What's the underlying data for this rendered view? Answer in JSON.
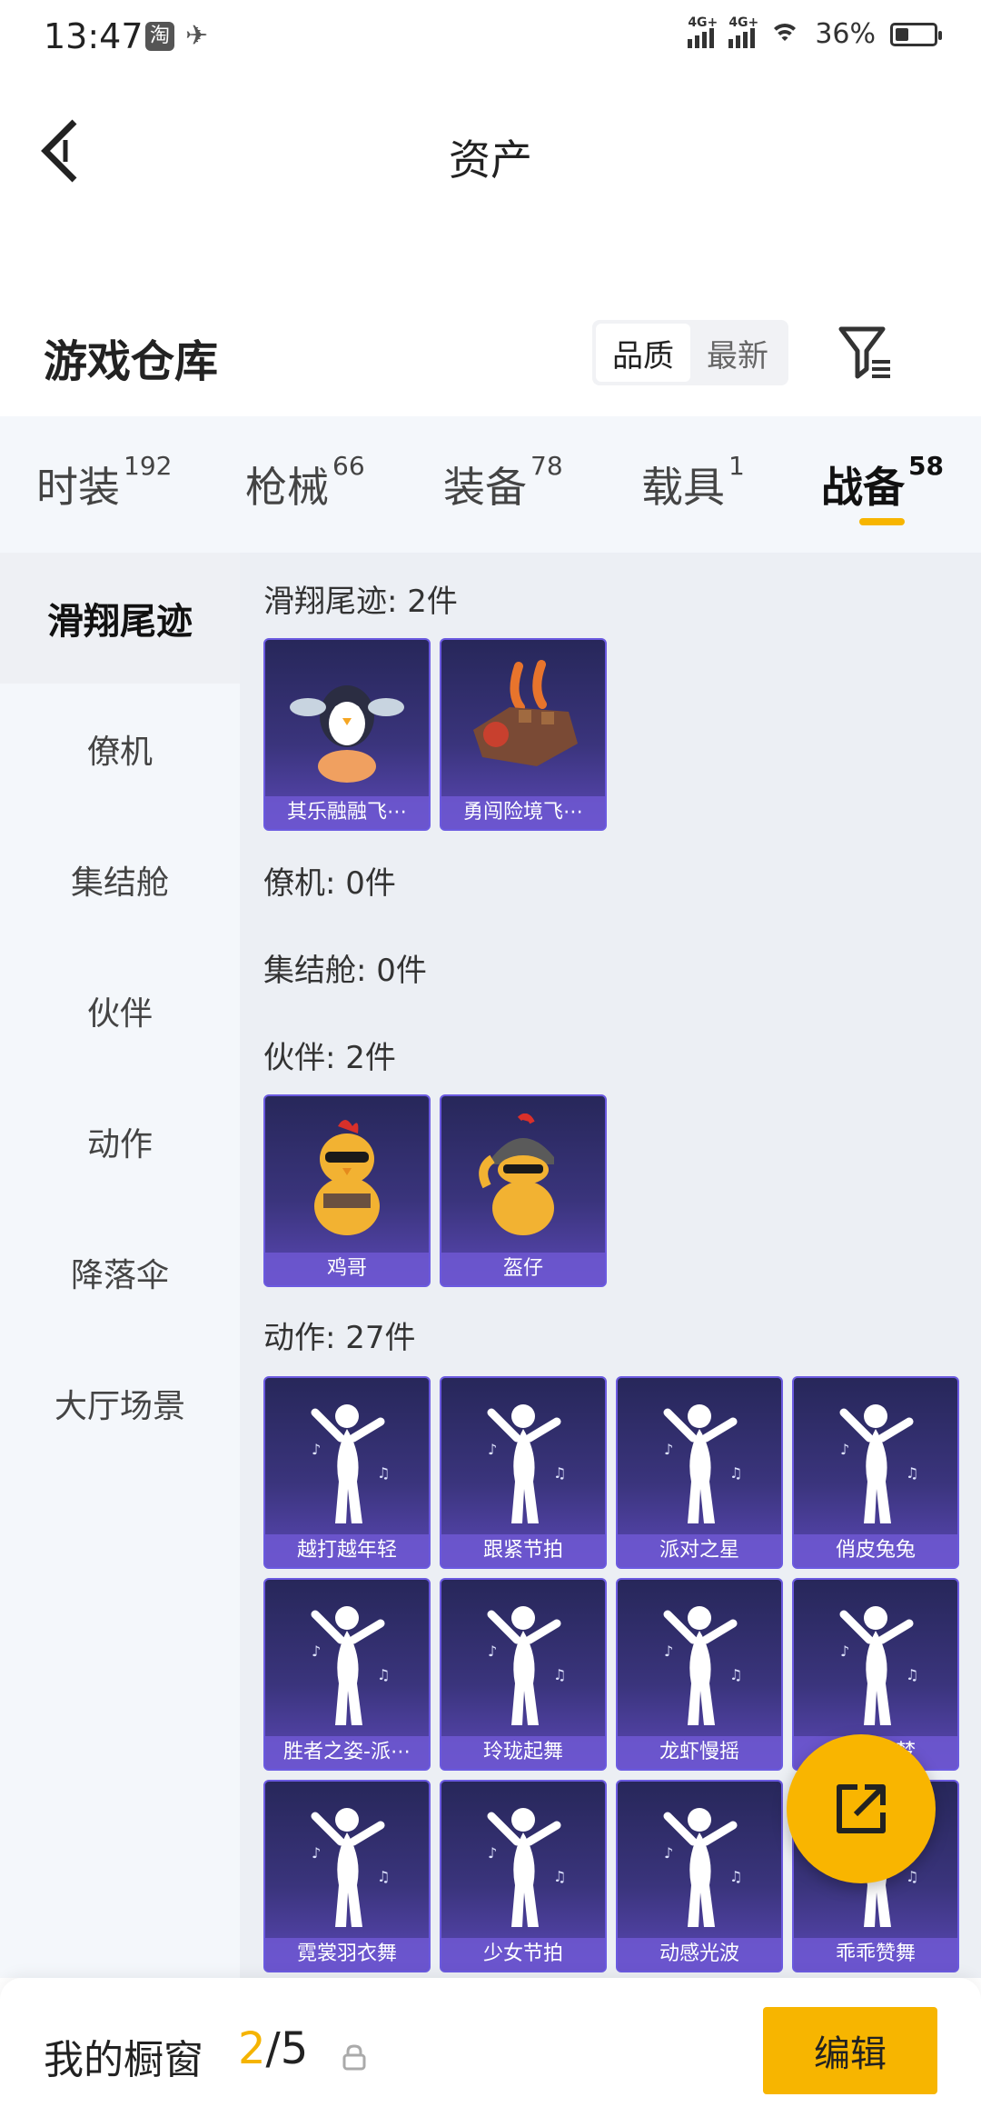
{
  "status_bar": {
    "time": "13:47",
    "app_icon_1": "taobao-icon",
    "app_icon_2": "fish-icon",
    "network_1": "4G+",
    "network_2": "4G+",
    "battery_percent": "36%",
    "battery_level": 0.36
  },
  "header": {
    "title": "资产",
    "back_icon": "back-chevron-icon"
  },
  "warehouse": {
    "title": "游戏仓库",
    "sort_options": [
      "品质",
      "最新"
    ],
    "sort_selected": "品质",
    "filter_icon": "filter-icon"
  },
  "tabs": [
    {
      "label": "时装",
      "count": "192"
    },
    {
      "label": "枪械",
      "count": "66"
    },
    {
      "label": "装备",
      "count": "78"
    },
    {
      "label": "载具",
      "count": "1"
    },
    {
      "label": "战备",
      "count": "58",
      "active": true
    }
  ],
  "sidebar": {
    "items": [
      "滑翔尾迹",
      "僚机",
      "集结舱",
      "伙伴",
      "动作",
      "降落伞",
      "大厅场景"
    ],
    "active": "滑翔尾迹"
  },
  "groups": [
    {
      "title": "滑翔尾迹: 2件",
      "items": [
        {
          "label": "其乐融融飞⋯",
          "icon": "penguin-glider-icon"
        },
        {
          "label": "勇闯险境飞⋯",
          "icon": "rocket-glider-icon"
        }
      ]
    },
    {
      "title": "僚机: 0件",
      "items": []
    },
    {
      "title": "集结舱: 0件",
      "items": []
    },
    {
      "title": "伙伴: 2件",
      "items": [
        {
          "label": "鸡哥",
          "icon": "chicken-sunglasses-icon"
        },
        {
          "label": "盔仔",
          "icon": "chicken-helmet-icon"
        }
      ]
    },
    {
      "title": "动作: 27件",
      "items": [
        {
          "label": "越打越年轻",
          "icon": "dance-pose-icon"
        },
        {
          "label": "跟紧节拍",
          "icon": "dance-pose-icon"
        },
        {
          "label": "派对之星",
          "icon": "dance-pose-icon"
        },
        {
          "label": "俏皮兔兔",
          "icon": "dance-pose-icon"
        },
        {
          "label": "胜者之姿-派⋯",
          "icon": "dance-pose-icon"
        },
        {
          "label": "玲珑起舞",
          "icon": "dance-pose-icon"
        },
        {
          "label": "龙虾慢摇",
          "icon": "dance-pose-icon"
        },
        {
          "label": "指尖绕梦",
          "icon": "dance-pose-icon"
        },
        {
          "label": "霓裳羽衣舞",
          "icon": "dance-pose-icon"
        },
        {
          "label": "少女节拍",
          "icon": "dance-pose-icon"
        },
        {
          "label": "动感光波",
          "icon": "dance-pose-icon"
        },
        {
          "label": "乖乖赞舞",
          "icon": "dance-pose-icon"
        }
      ]
    }
  ],
  "share_button_icon": "share-external-icon",
  "bottom_bar": {
    "label": "我的橱窗",
    "current": "2",
    "separator": "/",
    "total": "5",
    "lock_icon": "lock-icon",
    "edit_label": "编辑"
  },
  "colors": {
    "accent": "#f7b500",
    "card_dark": "#27275a",
    "card_light": "#5b48b6",
    "tab_bg": "#f4f7fb",
    "content_bg": "#eceff4"
  }
}
